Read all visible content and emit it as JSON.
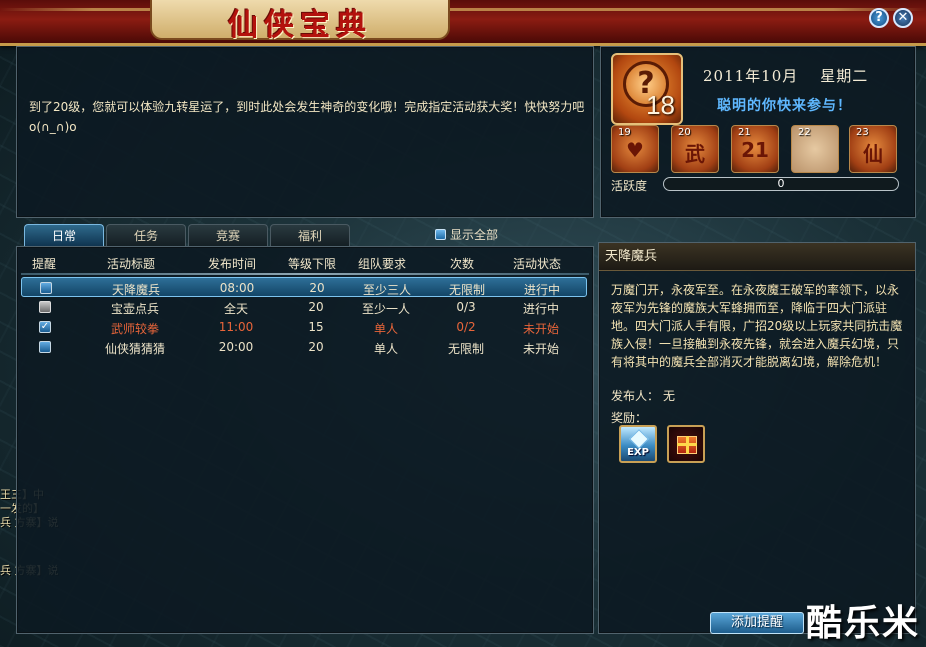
{
  "header": {
    "title": "仙侠宝典",
    "help_icon": "question-icon",
    "close_icon": "close-icon"
  },
  "intro": {
    "text": "到了20级，您就可以体验九转星运了，到时此处会发生神奇的变化哦！完成指定活动获大奖！快快努力吧o(∩_∩)o"
  },
  "calendar": {
    "today": "18",
    "year_month": "2011年10月",
    "weekday": "星期二",
    "slogan": "聪明的你快来参与！",
    "upcoming": [
      {
        "day": "19",
        "glyph": "♥"
      },
      {
        "day": "20",
        "glyph": "武"
      },
      {
        "day": "21",
        "glyph": "21"
      },
      {
        "day": "22",
        "glyph": ""
      },
      {
        "day": "23",
        "glyph": "仙"
      }
    ],
    "activity_label": "活跃度",
    "activity_value": "0"
  },
  "tabs": [
    {
      "label": "日常",
      "active": true
    },
    {
      "label": "任务",
      "active": false
    },
    {
      "label": "竞赛",
      "active": false
    },
    {
      "label": "福利",
      "active": false
    }
  ],
  "show_all_label": "显示全部",
  "table": {
    "headers": [
      "提醒",
      "活动标题",
      "发布时间",
      "等级下限",
      "组队要求",
      "次数",
      "活动状态"
    ],
    "rows": [
      {
        "checked": false,
        "title": "天降魔兵",
        "time": "08:00",
        "level": "20",
        "team": "至少三人",
        "count": "无限制",
        "status": "进行中",
        "selected": true
      },
      {
        "checked": false,
        "title": "宝壶点兵",
        "time": "全天",
        "level": "20",
        "team": "至少一人",
        "count": "0/3",
        "status": "进行中",
        "selected": false
      },
      {
        "checked": true,
        "title": "武师较拳",
        "time": "11:00",
        "level": "15",
        "team": "单人",
        "count": "0/2",
        "status": "未开始",
        "selected": false
      },
      {
        "checked": false,
        "title": "仙侠猜猜猜",
        "time": "20:00",
        "level": "20",
        "team": "单人",
        "count": "无限制",
        "status": "未开始",
        "selected": false
      }
    ]
  },
  "detail": {
    "title": "天降魔兵",
    "description": "万魔门开，永夜军至。在永夜魔王破军的率领下，以永夜军为先锋的魔族大军蜂拥而至，降临于四大门派驻地。四大门派人手有限，广招20级以上玩家共同抗击魔族入侵！一旦接触到永夜先锋，就会进入魔兵幻境，只有将其中的魔兵全部消灭才能脱离幻境，解除危机！",
    "publisher_label": "发布人：",
    "publisher_value": "无",
    "reward_label": "奖励：",
    "rewards": [
      {
        "icon": "exp-icon",
        "label": "EXP"
      },
      {
        "icon": "gift-box-icon"
      }
    ]
  },
  "add_reminder_label": "添加提醒",
  "watermark": "酷乐米",
  "colors": {
    "banner_red": "#8b1c12",
    "accent_blue": "#2e6f98",
    "hot_text": "#e8653a",
    "slogan_blue": "#5fb8ff"
  }
}
